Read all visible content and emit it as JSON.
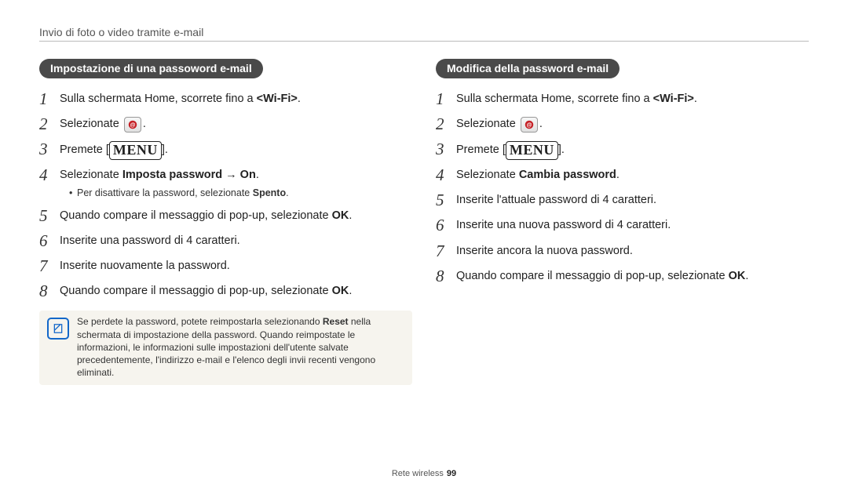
{
  "header": {
    "title": "Invio di foto o video tramite e-mail"
  },
  "left": {
    "pill": "Impostazione di una passoword e-mail",
    "steps": {
      "1": {
        "pre": "Sulla schermata Home, scorrete fino a ",
        "bold": "<Wi-Fi>",
        "post": "."
      },
      "2": {
        "pre": "Selezionate ",
        "post": "."
      },
      "3": {
        "pre": "Premete [",
        "post": "]."
      },
      "4": {
        "pre": "Selezionate ",
        "bold": "Imposta password → On",
        "post": ".",
        "bullet_pre": "Per disattivare la password, selezionate ",
        "bullet_bold": "Spento",
        "bullet_post": "."
      },
      "5": {
        "pre": "Quando compare il messaggio di pop-up, selezionate ",
        "bold": "OK",
        "post": "."
      },
      "6": {
        "pre": "Inserite una password di 4 caratteri."
      },
      "7": {
        "pre": "Inserite nuovamente la password."
      },
      "8": {
        "pre": "Quando compare il messaggio di pop-up, selezionate ",
        "bold": "OK",
        "post": "."
      }
    },
    "note": {
      "t1": "Se perdete la password, potete reimpostarla selezionando ",
      "b1": "Reset",
      "t2": " nella schermata di impostazione della password. Quando reimpostate le informazioni, le informazioni sulle impostazioni dell'utente salvate precedentemente, l'indirizzo e-mail e l'elenco degli invii recenti vengono eliminati."
    }
  },
  "right": {
    "pill": "Modifica della password e-mail",
    "steps": {
      "1": {
        "pre": "Sulla schermata Home, scorrete fino a ",
        "bold": "<Wi-Fi>",
        "post": "."
      },
      "2": {
        "pre": "Selezionate ",
        "post": "."
      },
      "3": {
        "pre": "Premete [",
        "post": "]."
      },
      "4": {
        "pre": "Selezionate ",
        "bold": "Cambia password",
        "post": "."
      },
      "5": {
        "pre": "Inserite l'attuale password di 4 caratteri."
      },
      "6": {
        "pre": "Inserite una nuova password di 4 caratteri."
      },
      "7": {
        "pre": "Inserite ancora la nuova password."
      },
      "8": {
        "pre": "Quando compare il messaggio di pop-up, selezionate ",
        "bold": "OK",
        "post": "."
      }
    }
  },
  "menu_label": "MENU",
  "footer": {
    "section": "Rete wireless",
    "page": "99"
  }
}
